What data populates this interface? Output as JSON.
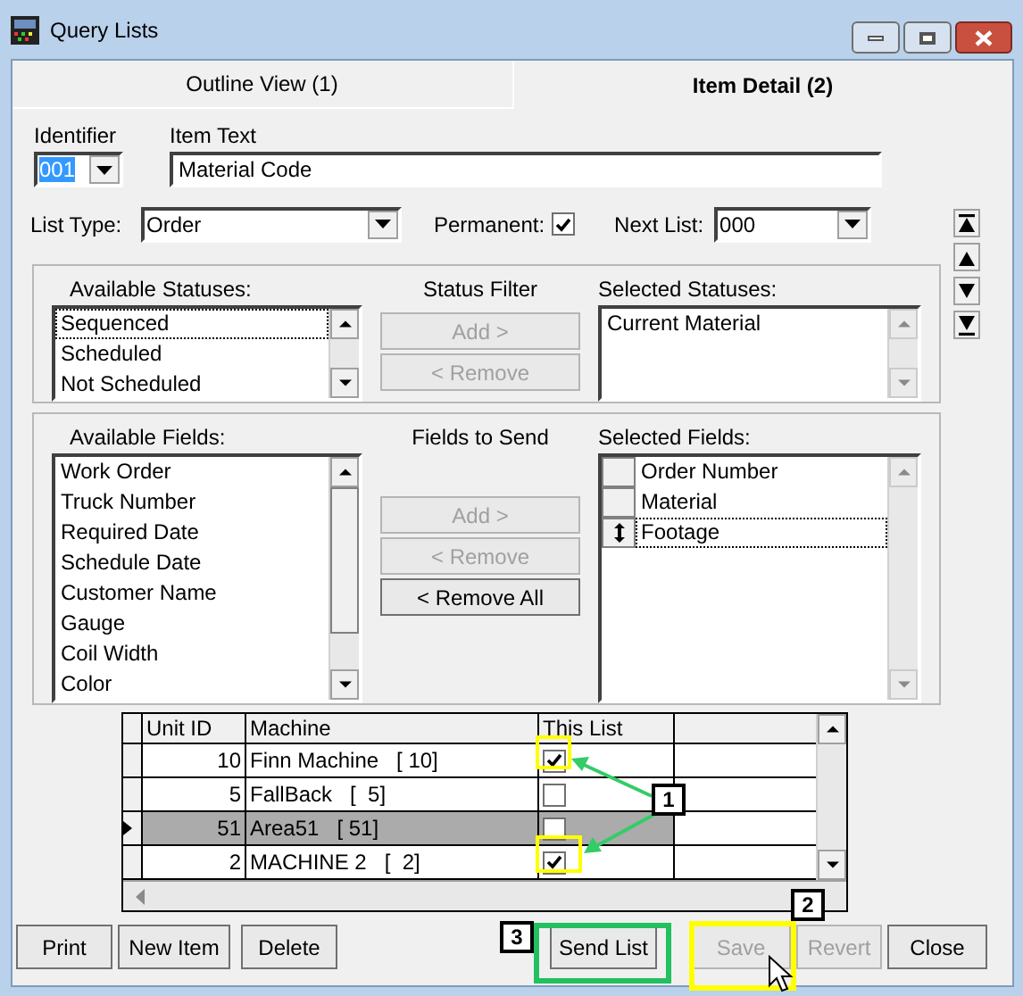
{
  "window": {
    "title": "Query Lists"
  },
  "tabs": [
    {
      "label": "Outline View (1)",
      "selected": false
    },
    {
      "label": "Item Detail (2)",
      "selected": true
    }
  ],
  "identifier": {
    "label": "Identifier",
    "value": "001"
  },
  "item_text": {
    "label": "Item Text",
    "value": "Material Code"
  },
  "list_type": {
    "label": "List Type:",
    "value": "Order"
  },
  "permanent": {
    "label": "Permanent:",
    "checked": true
  },
  "next_list": {
    "label": "Next List:",
    "value": "000"
  },
  "status_filter": {
    "title": "Status Filter",
    "available_label": "Available Statuses:",
    "available": [
      {
        "label": "Sequenced",
        "selected": true
      },
      {
        "label": "Scheduled",
        "selected": false
      },
      {
        "label": "Not Scheduled",
        "selected": false
      }
    ],
    "buttons": [
      {
        "label": "Add >",
        "disabled": true
      },
      {
        "label": "< Remove",
        "disabled": true
      }
    ],
    "selected_label": "Selected Statuses:",
    "selected_items": [
      {
        "label": "Current Material",
        "selected": false
      }
    ]
  },
  "fields_to_send": {
    "title": "Fields to Send",
    "available_label": "Available Fields:",
    "available": [
      {
        "label": "Work Order",
        "selected": false
      },
      {
        "label": "Truck Number",
        "selected": false
      },
      {
        "label": "Required Date",
        "selected": false
      },
      {
        "label": "Schedule Date",
        "selected": false
      },
      {
        "label": "Customer Name",
        "selected": false
      },
      {
        "label": "Gauge",
        "selected": false
      },
      {
        "label": "Coil Width",
        "selected": false
      },
      {
        "label": "Color",
        "selected": false
      }
    ],
    "buttons": [
      {
        "label": "Add >",
        "disabled": true
      },
      {
        "label": "< Remove",
        "disabled": true
      },
      {
        "label": "< Remove All",
        "disabled": false
      }
    ],
    "selected_label": "Selected Fields:",
    "selected_items": [
      {
        "label": "Order Number",
        "selected": false
      },
      {
        "label": "Material",
        "selected": false
      },
      {
        "label": "Footage",
        "selected": true
      }
    ]
  },
  "grid": {
    "columns": [
      "Unit ID",
      "Machine",
      "This List"
    ],
    "rows": [
      {
        "unit_id": "10",
        "machine": "Finn Machine   [ 10]",
        "this_list": true,
        "selected": false
      },
      {
        "unit_id": "5",
        "machine": "FallBack   [  5]",
        "this_list": false,
        "selected": false
      },
      {
        "unit_id": "51",
        "machine": "Area51   [ 51]",
        "this_list": false,
        "selected": true
      },
      {
        "unit_id": "2",
        "machine": "MACHINE 2   [  2]",
        "this_list": true,
        "selected": false
      }
    ]
  },
  "buttons": [
    {
      "label": "Print",
      "disabled": false
    },
    {
      "label": "New Item",
      "disabled": false
    },
    {
      "label": "Delete",
      "disabled": false
    },
    {
      "label": "Send List",
      "disabled": false
    },
    {
      "label": "Save",
      "disabled": true
    },
    {
      "label": "Revert",
      "disabled": true
    },
    {
      "label": "Close",
      "disabled": false
    }
  ],
  "callouts": [
    "1",
    "2",
    "3"
  ]
}
